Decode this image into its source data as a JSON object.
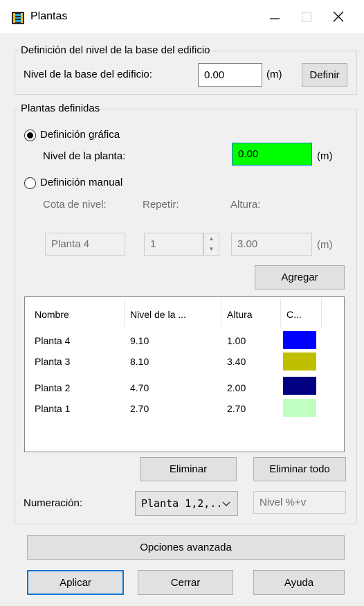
{
  "window": {
    "title": "Plantas"
  },
  "base_group": {
    "legend": "Definición del nivel de la base del edificio",
    "label": "Nivel de la base del edificio:",
    "value": "0.00",
    "unit": "(m)",
    "define_button": "Definir"
  },
  "plants_group": {
    "legend": "Plantas definidas",
    "graphic": {
      "radio_label": "Definición gráfica",
      "selected": true,
      "level_label": "Nivel de la planta:",
      "level_value": "0.00",
      "unit": "(m)",
      "field_color": "#00ff00"
    },
    "manual": {
      "radio_label": "Definición manual",
      "selected": false,
      "cota_label": "Cota de nivel:",
      "repeat_label": "Repetir:",
      "height_label": "Altura:",
      "cota_value": "Planta 4",
      "repeat_value": "1",
      "height_value": "3.00",
      "unit": "(m)"
    },
    "add_button": "Agregar",
    "table": {
      "columns": [
        "Nombre",
        "Nivel de la ...",
        "Altura",
        "C..."
      ],
      "rows": [
        {
          "name": "Planta 4",
          "level": "9.10",
          "height": "1.00",
          "color": "#0000ff"
        },
        {
          "name": "Planta 3",
          "level": "8.10",
          "height": "3.40",
          "color": "#bfbf00"
        },
        {
          "name": "Planta 2",
          "level": "4.70",
          "height": "2.00",
          "color": "#000080"
        },
        {
          "name": "Planta 1",
          "level": "2.70",
          "height": "2.70",
          "color": "#c0ffc0"
        }
      ]
    },
    "delete_button": "Eliminar",
    "delete_all_button": "Eliminar todo",
    "numbering_label": "Numeración:",
    "numbering_value": "Planta 1,2,..",
    "numbering_format": "Nivel %+v"
  },
  "footer": {
    "advanced_button": "Opciones avanzada",
    "apply_button": "Aplicar",
    "close_button": "Cerrar",
    "help_button": "Ayuda"
  },
  "icons": {
    "app": "building-floors-icon",
    "minimize": "minimize-icon",
    "maximize": "maximize-icon",
    "close": "close-icon",
    "spin": "spinner-arrows-icon",
    "dropdown": "chevron-down-icon"
  }
}
